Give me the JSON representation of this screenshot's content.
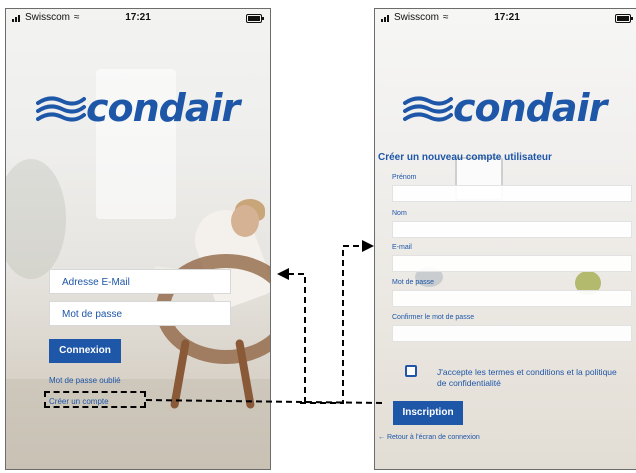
{
  "status_bar": {
    "carrier": "Swisscom",
    "time": "17:21"
  },
  "login_screen": {
    "brand": "condair",
    "email_placeholder": "Adresse E-Mail",
    "password_placeholder": "Mot de passe",
    "login_button": "Connexion",
    "forgot_password_link": "Mot de passe oublié",
    "create_account_link": "Créer un compte"
  },
  "register_screen": {
    "brand": "condair",
    "heading": "Créer un nouveau compte utilisateur",
    "fields": [
      {
        "label": "Prénom"
      },
      {
        "label": "Nom"
      },
      {
        "label": "E-mail"
      },
      {
        "label": "Mot de passe"
      },
      {
        "label": "Confirmer le mot de passe"
      }
    ],
    "terms_text": "J'accepte les termes et conditions et la politique de confidentialité",
    "terms_checked": false,
    "register_button": "Inscription",
    "back_link": "← Retour à l'écran de connexion"
  },
  "colors": {
    "brand_blue": "#1e56a8",
    "annotation": "#000000"
  }
}
